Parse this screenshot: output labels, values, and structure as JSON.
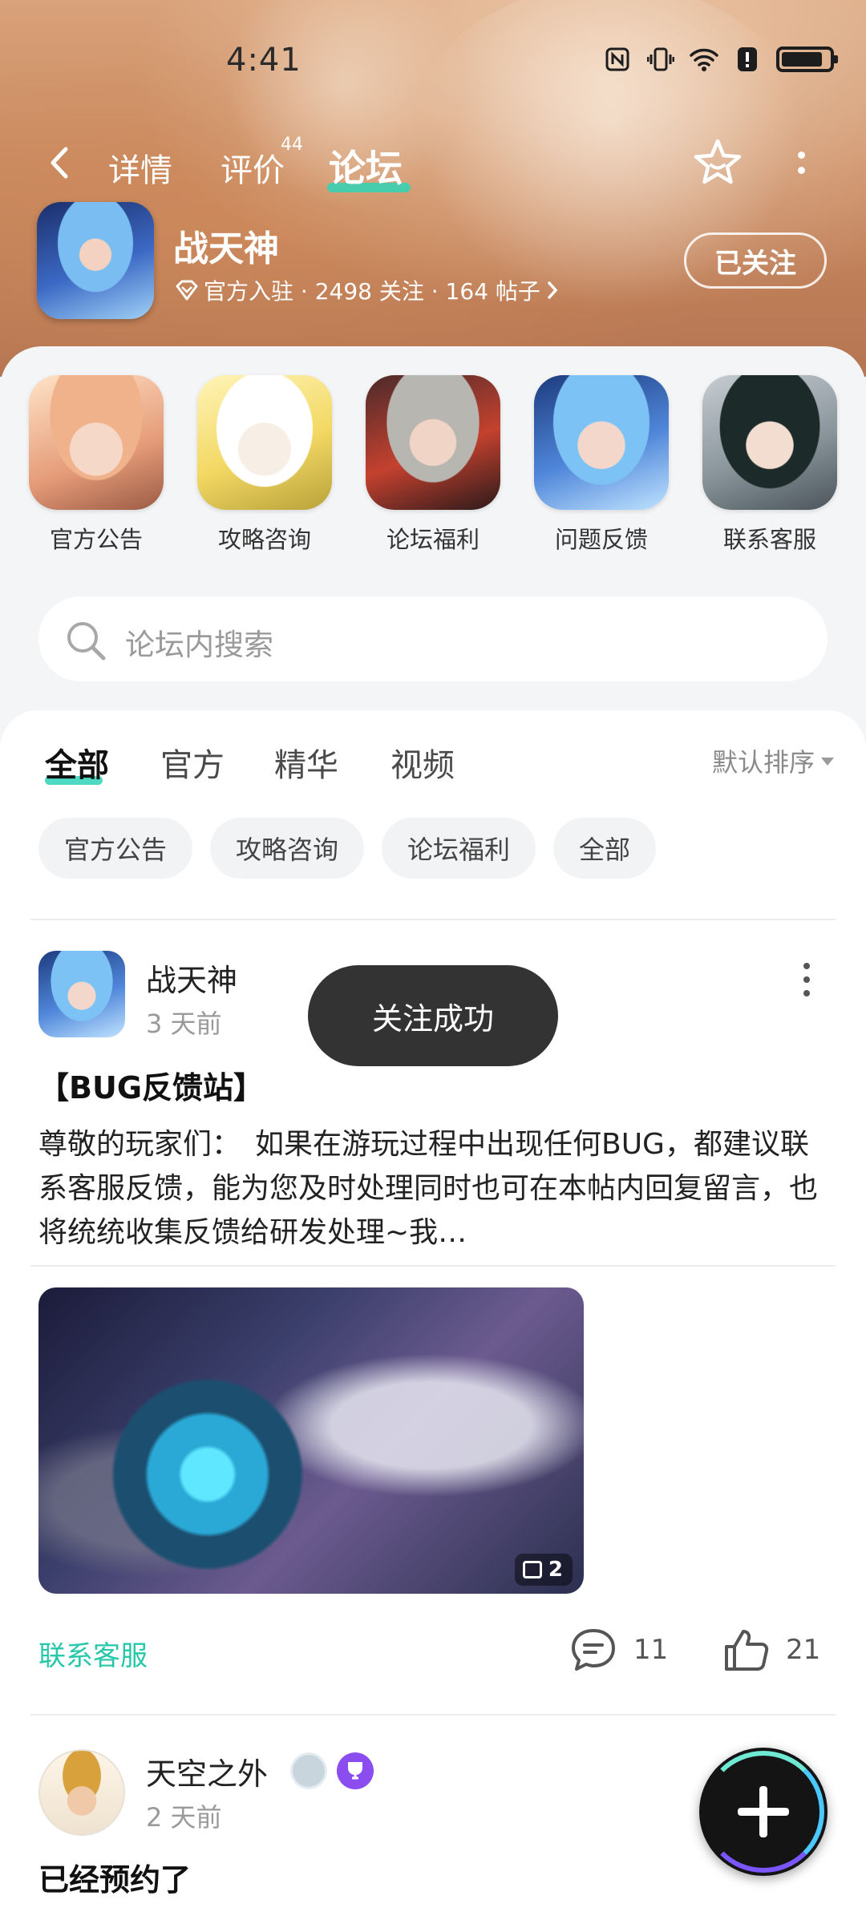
{
  "status_bar": {
    "time": "4:41"
  },
  "nav": {
    "tabs": [
      {
        "label": "详情"
      },
      {
        "label": "评价",
        "count": "44"
      },
      {
        "label": "论坛"
      }
    ]
  },
  "game": {
    "name": "战天神",
    "meta": "官方入驻 · 2498 关注 · 164 帖子",
    "follow_label": "已关注"
  },
  "categories": [
    {
      "label": "官方公告"
    },
    {
      "label": "攻略咨询"
    },
    {
      "label": "论坛福利"
    },
    {
      "label": "问题反馈"
    },
    {
      "label": "联系客服"
    }
  ],
  "search": {
    "placeholder": "论坛内搜索"
  },
  "feed_tabs": [
    {
      "label": "全部"
    },
    {
      "label": "官方"
    },
    {
      "label": "精华"
    },
    {
      "label": "视频"
    }
  ],
  "sort_label": "默认排序",
  "chips": [
    {
      "label": "官方公告"
    },
    {
      "label": "攻略咨询"
    },
    {
      "label": "论坛福利"
    },
    {
      "label": "全部"
    }
  ],
  "posts": [
    {
      "author": "战天神",
      "time": "3 天前",
      "title": "【BUG反馈站】",
      "body": "尊敬的玩家们：　如果在游玩过程中出现任何BUG，都建议联系客服反馈，能为您及时处理同时也可在本帖内回复留言，也将统统收集反馈给研发处理~我…",
      "image_count": "2",
      "tag": "联系客服",
      "comments": "11",
      "likes": "21"
    },
    {
      "author": "天空之外",
      "time": "2 天前",
      "title": "已经预约了"
    }
  ],
  "toast": "关注成功",
  "colors": {
    "accent": "#2fd3b7",
    "tag": "#27c7a9",
    "toast_bg": "#333333"
  }
}
